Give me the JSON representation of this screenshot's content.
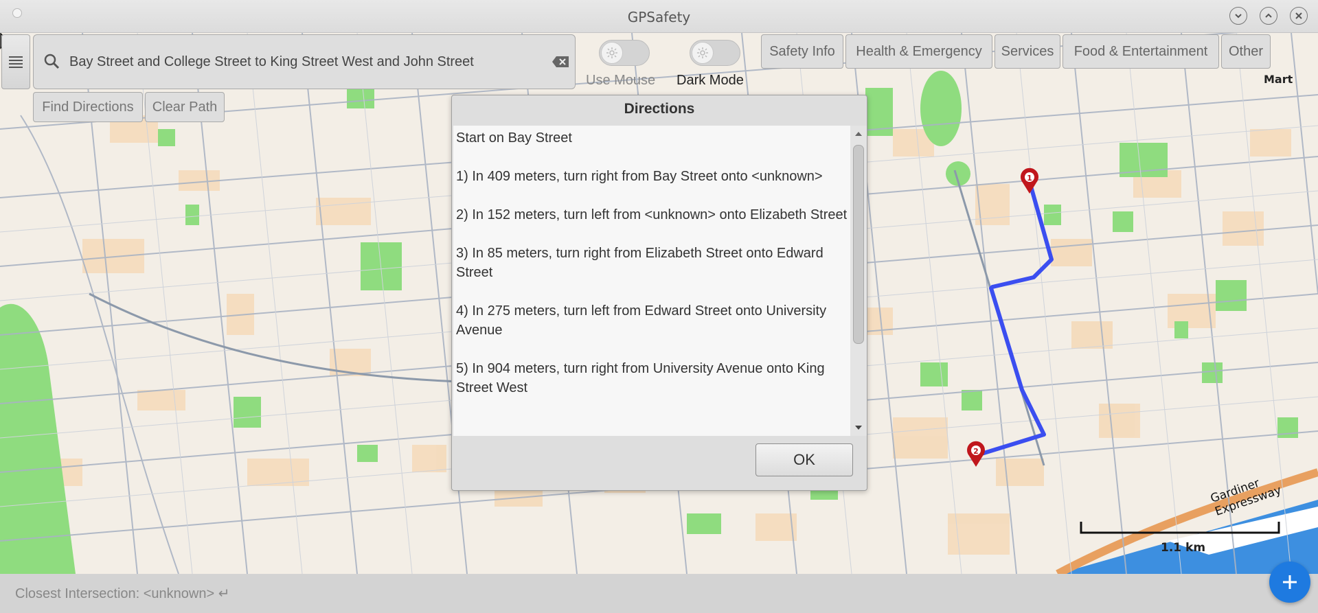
{
  "window": {
    "title": "GPSafety"
  },
  "search": {
    "value": "Bay Street and College Street to King Street West and John Street"
  },
  "toggles": [
    {
      "label": "Use Mouse",
      "on": false
    },
    {
      "label": "Dark Mode",
      "on": false
    }
  ],
  "categories": [
    "Safety Info",
    "Health & Emergency",
    "Services",
    "Food & Entertainment",
    "Other"
  ],
  "actions": {
    "find": "Find Directions",
    "clear": "Clear Path"
  },
  "dialog": {
    "title": "Directions",
    "steps": [
      "Start on Bay Street",
      "1) In 409 meters, turn right from Bay Street onto <unknown>",
      "2) In 152 meters, turn left from <unknown> onto Elizabeth Street",
      "3) In 85 meters, turn right from Elizabeth Street onto Edward Street",
      "4) In 275 meters, turn left from Edward Street onto University Avenue",
      "5) In 904 meters, turn right from University Avenue onto King Street West"
    ],
    "ok_label": "OK"
  },
  "map": {
    "scale_label": "1.1 km",
    "road_label": "Gardiner Expressway",
    "poi_label": "Mart",
    "marker_start": "1",
    "marker_end": "2",
    "route_color": "#3b4ef0"
  },
  "status": {
    "closest_intersection": "Closest Intersection: <unknown> ↵"
  },
  "colors": {
    "accent": "#1e7ae0",
    "marker": "#c0161c",
    "park": "#8fdc7f",
    "water": "#3d8fe0"
  }
}
